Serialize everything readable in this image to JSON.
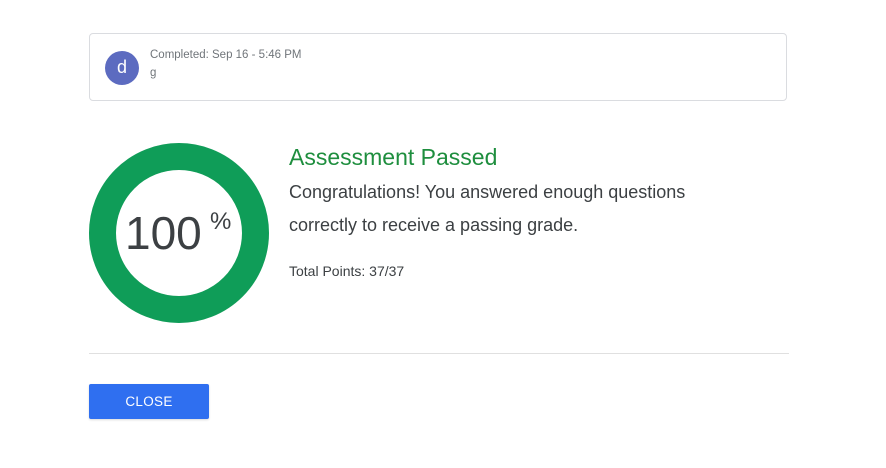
{
  "submission": {
    "avatar_letter": "d",
    "completed_text": "Completed: Sep 16 - 5:46 PM",
    "user_name": "g"
  },
  "result": {
    "percent_value": "100",
    "percent_unit": "%",
    "score_fraction": 1.0,
    "ring_color": "#0f9d58",
    "title": "Assessment Passed",
    "title_color": "#1e8e3e",
    "message": "Congratulations! You answered enough questions correctly to receive a passing grade.",
    "total_points": "Total Points: 37/37"
  },
  "actions": {
    "close_label": "CLOSE",
    "close_color": "#2f6ff0"
  },
  "colors": {
    "avatar": "#5c6bc0",
    "card_border": "#dadce0"
  }
}
